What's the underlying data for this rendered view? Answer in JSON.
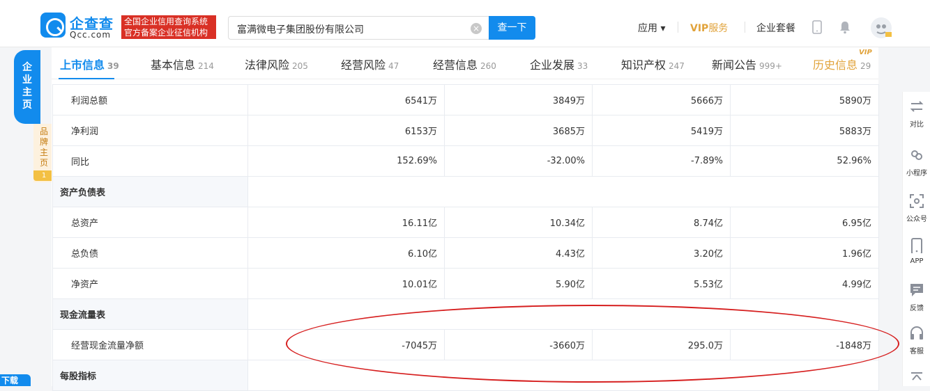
{
  "header": {
    "logo_cn": "企查查",
    "logo_en": "Qcc.com",
    "slogan_line1": "全国企业信用查询系统",
    "slogan_line2": "官方备案企业征信机构",
    "search_value": "富满微电子集团股份有限公司",
    "search_button": "查一下",
    "apps": "应用 ▾",
    "vip_label": "VIP",
    "vip_service": "服务",
    "package": "企业套餐"
  },
  "left_sidebar": {
    "main": "企业主页",
    "sub": "品牌主页",
    "sub_count": "1"
  },
  "tabs": [
    {
      "label": "上市信息",
      "count": "39"
    },
    {
      "label": "基本信息",
      "count": "214"
    },
    {
      "label": "法律风险",
      "count": "205"
    },
    {
      "label": "经营风险",
      "count": "47"
    },
    {
      "label": "经营信息",
      "count": "260"
    },
    {
      "label": "企业发展",
      "count": "33"
    },
    {
      "label": "知识产权",
      "count": "247"
    },
    {
      "label": "新闻公告",
      "count": "999+"
    },
    {
      "label": "历史信息",
      "count": "29"
    }
  ],
  "vip_badge": "VIP",
  "rows": {
    "profit_total": {
      "label": "利润总额",
      "v": [
        "6541万",
        "3849万",
        "5666万",
        "5890万"
      ]
    },
    "net_profit": {
      "label": "净利润",
      "v": [
        "6153万",
        "3685万",
        "5419万",
        "5883万"
      ]
    },
    "yoy": {
      "label": "同比",
      "v": [
        "152.69%",
        "-32.00%",
        "-7.89%",
        "52.96%"
      ]
    },
    "balance_section": "资产负债表",
    "total_assets": {
      "label": "总资产",
      "v": [
        "16.11亿",
        "10.34亿",
        "8.74亿",
        "6.95亿"
      ]
    },
    "total_liab": {
      "label": "总负债",
      "v": [
        "6.10亿",
        "4.43亿",
        "3.20亿",
        "1.96亿"
      ]
    },
    "net_assets": {
      "label": "净资产",
      "v": [
        "10.01亿",
        "5.90亿",
        "5.53亿",
        "4.99亿"
      ]
    },
    "cashflow_section": "现金流量表",
    "op_cashflow": {
      "label": "经营现金流量净额",
      "v": [
        "-7045万",
        "-3660万",
        "295.0万",
        "-1848万"
      ]
    },
    "per_share_section": "每股指标"
  },
  "right_sidebar": {
    "compare": "对比",
    "miniapp": "小程序",
    "official": "公众号",
    "app": "APP",
    "feedback": "反馈",
    "service": "客服"
  },
  "corner_text": "下载"
}
